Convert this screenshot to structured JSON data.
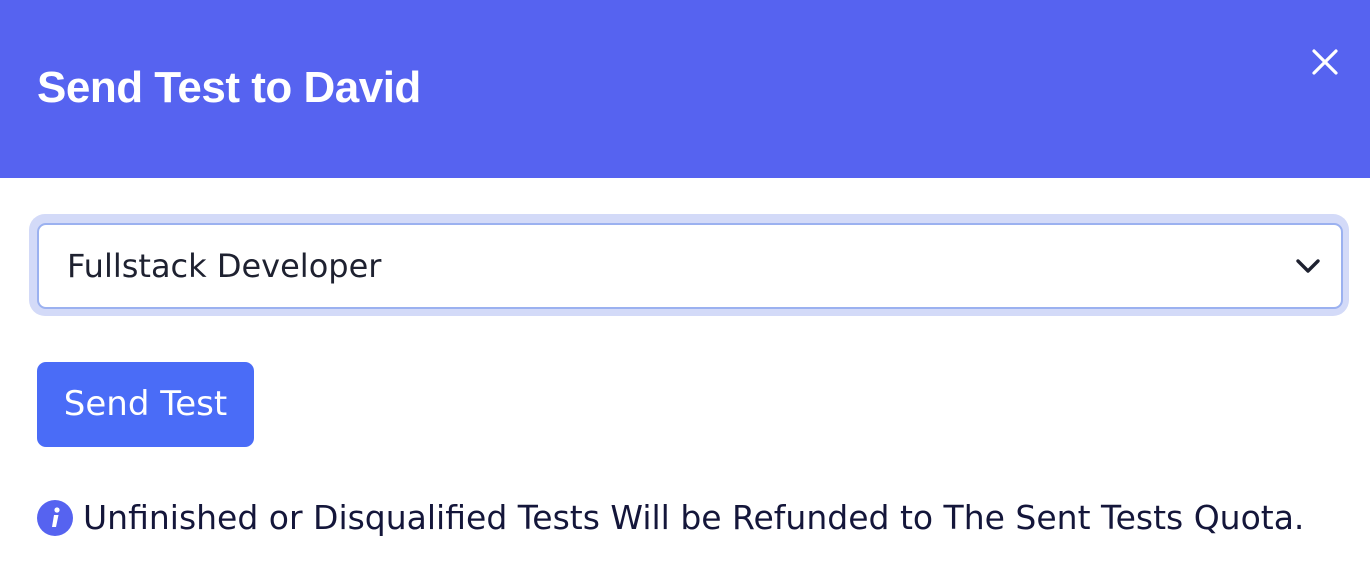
{
  "dialog": {
    "title": "Send Test to David",
    "close_icon": "close-icon"
  },
  "test_select": {
    "selected_value": "Fullstack Developer",
    "dropdown_icon": "chevron-down-icon"
  },
  "actions": {
    "send_label": "Send Test"
  },
  "notice": {
    "icon": "info-icon",
    "text": "Unfinished or Disqualified Tests Will be Refunded to The Sent Tests Quota."
  },
  "colors": {
    "header_bg": "#5663f0",
    "primary_button": "#4a6cf7",
    "focus_ring": "#d3daf8",
    "select_border": "#9bb1f0",
    "info_icon": "#5663f0"
  }
}
